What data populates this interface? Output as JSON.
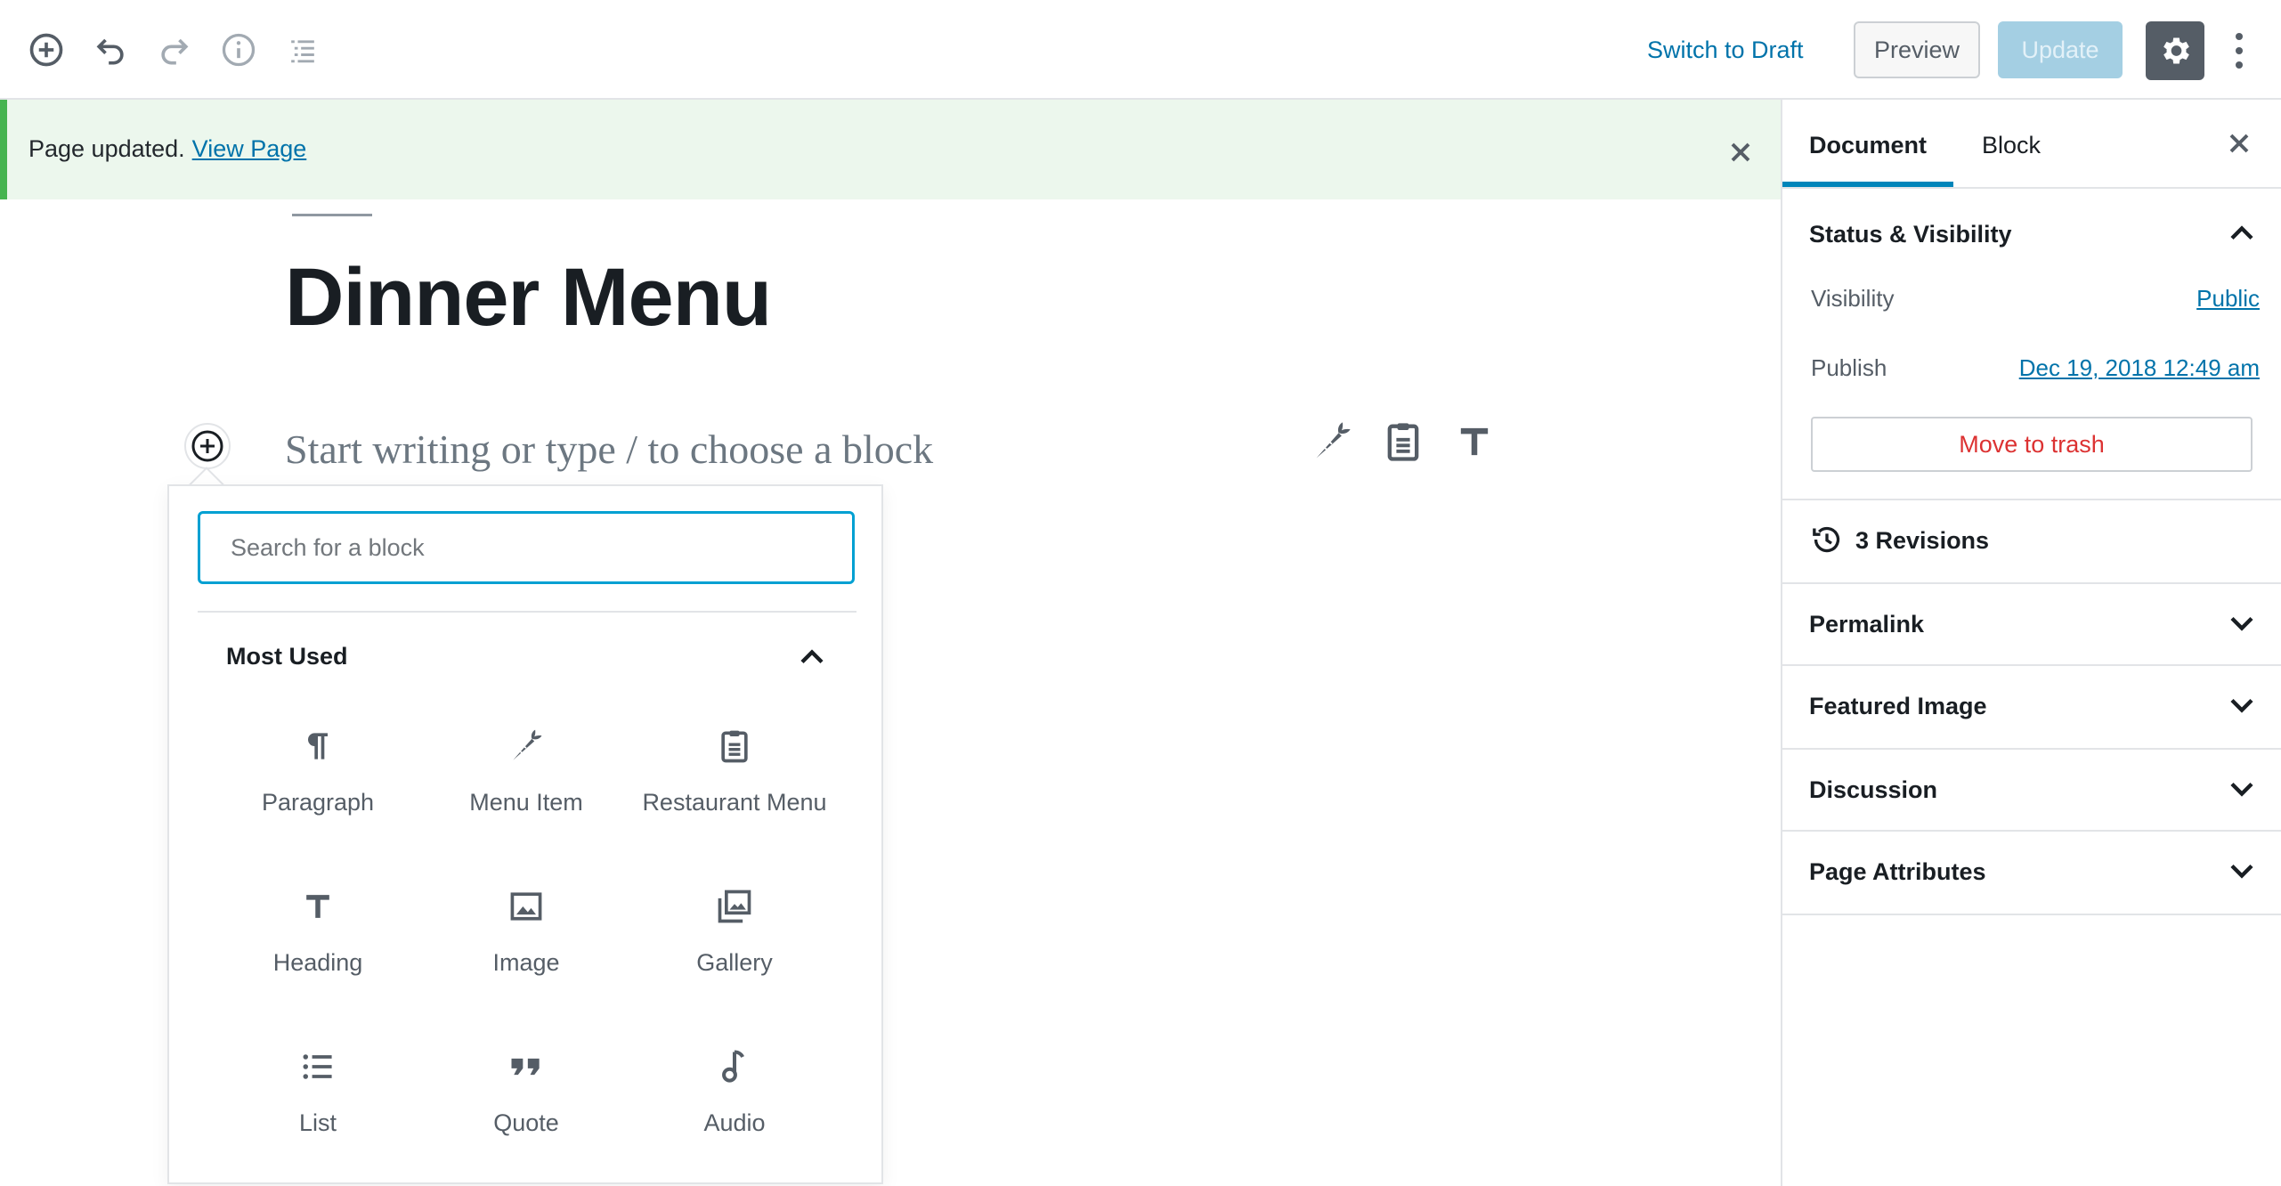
{
  "toolbar": {
    "switch_to_draft": "Switch to Draft",
    "preview": "Preview",
    "update": "Update"
  },
  "notice": {
    "message": "Page updated.",
    "link": "View Page"
  },
  "editor": {
    "title": "Dinner Menu",
    "placeholder": "Start writing or type / to choose a block"
  },
  "inserter": {
    "search_placeholder": "Search for a block",
    "panel_title": "Most Used",
    "blocks": [
      {
        "label": "Paragraph",
        "icon": "paragraph-icon"
      },
      {
        "label": "Menu Item",
        "icon": "carrot-icon"
      },
      {
        "label": "Restaurant Menu",
        "icon": "clipboard-icon"
      },
      {
        "label": "Heading",
        "icon": "heading-icon"
      },
      {
        "label": "Image",
        "icon": "image-icon"
      },
      {
        "label": "Gallery",
        "icon": "gallery-icon"
      },
      {
        "label": "List",
        "icon": "list-icon"
      },
      {
        "label": "Quote",
        "icon": "quote-icon"
      },
      {
        "label": "Audio",
        "icon": "audio-icon"
      }
    ]
  },
  "sidebar": {
    "tabs": [
      "Document",
      "Block"
    ],
    "status": {
      "title": "Status & Visibility",
      "visibility_label": "Visibility",
      "visibility_value": "Public",
      "publish_label": "Publish",
      "publish_value": "Dec 19, 2018 12:49 am",
      "trash": "Move to trash"
    },
    "revisions": "3 Revisions",
    "panels": [
      "Permalink",
      "Featured Image",
      "Discussion",
      "Page Attributes"
    ]
  },
  "colors": {
    "accent": "#0073aa",
    "notice_bg": "#ecf7ed",
    "notice_border": "#46b450",
    "danger": "#dc3232",
    "update_disabled": "#a4cfe3"
  }
}
